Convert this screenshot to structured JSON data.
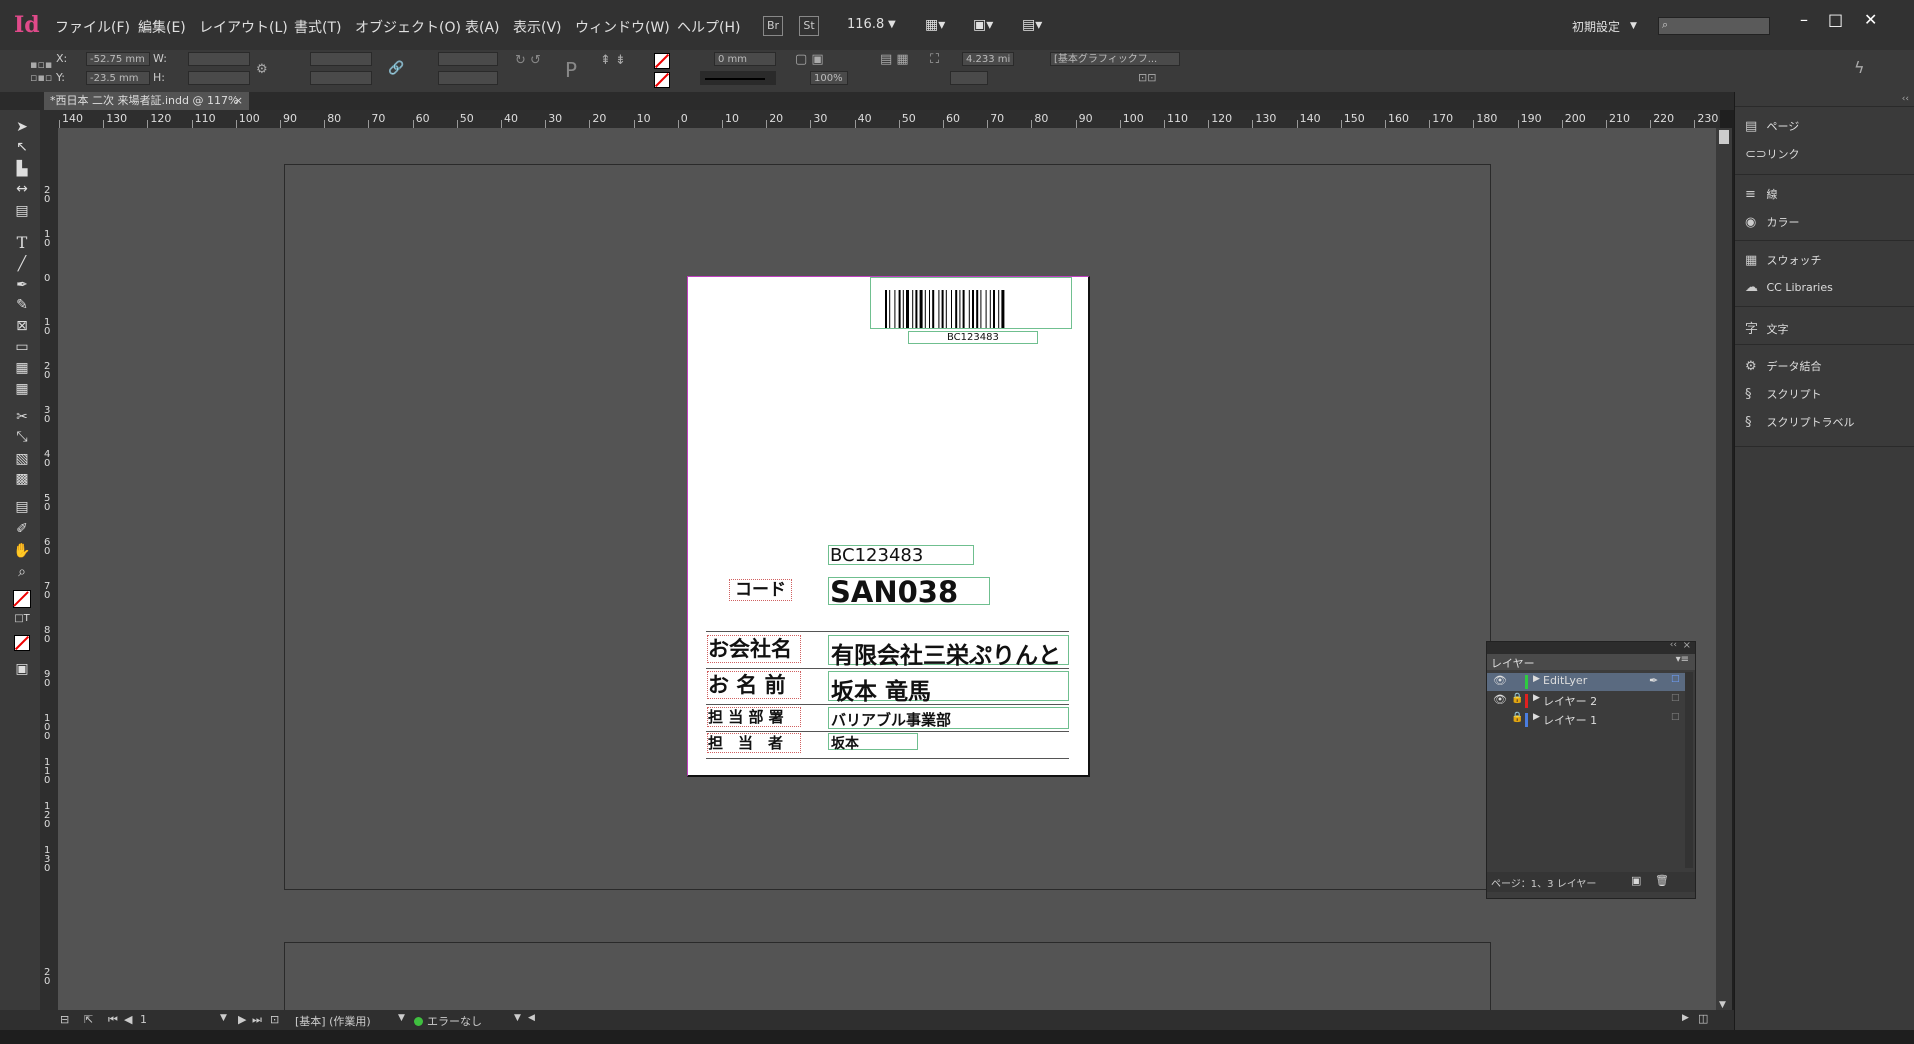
{
  "app": {
    "logo": "Id"
  },
  "menu": [
    "ファイル(F)",
    "編集(E)",
    "レイアウト(L)",
    "書式(T)",
    "オブジェクト(O)",
    "表(A)",
    "表示(V)",
    "ウィンドウ(W)",
    "ヘルプ(H)"
  ],
  "menubar": {
    "br": "Br",
    "st": "St",
    "zoom": "116.8",
    "workspace": "初期設定",
    "window_controls": [
      "–",
      "□",
      "✕"
    ]
  },
  "control": {
    "x_label": "X:",
    "x_value": "-52.75 mm",
    "y_label": "Y:",
    "y_value": "-23.5 mm",
    "w_label": "W:",
    "h_label": "H:",
    "stroke_weight": "0 mm",
    "opacity": "100%",
    "dimension": "4.233 mi",
    "object_style": "[基本グラフィックフ..."
  },
  "tab": {
    "title": "*西日本 二次 来場者証.indd @ 117%"
  },
  "ruler_h": [
    "140",
    "130",
    "120",
    "110",
    "100",
    "90",
    "80",
    "70",
    "60",
    "50",
    "40",
    "30",
    "20",
    "10",
    "0",
    "10",
    "20",
    "30",
    "40",
    "50",
    "60",
    "70",
    "80",
    "90",
    "100",
    "110",
    "120",
    "130",
    "140",
    "150",
    "160",
    "170",
    "180",
    "190",
    "200",
    "210",
    "220",
    "230"
  ],
  "ruler_v": [
    "2 0",
    "1 0",
    "0",
    "1 0",
    "2 0",
    "3 0",
    "4 0",
    "5 0",
    "6 0",
    "7 0",
    "8 0",
    "9 0",
    "1 0 0",
    "1 1 0",
    "1 2 0",
    "1 3 0",
    "2 0"
  ],
  "card": {
    "barcode_text": "BC123483",
    "code_small": "BC123483",
    "code_label": "コード",
    "code_value": "SAN038",
    "rows": [
      {
        "label": "お会社名",
        "value": "有限会社三栄ぷりんと"
      },
      {
        "label": "お 名 前",
        "value": "坂本 竜馬"
      },
      {
        "label": "担 当 部 署",
        "value": "バリアブル事業部"
      },
      {
        "label": "担　当　者",
        "value": "坂本"
      }
    ]
  },
  "dock": [
    {
      "icon": "pages-icon",
      "label": "ページ"
    },
    {
      "icon": "links-icon",
      "label": "リンク"
    },
    {
      "icon": "stroke-icon",
      "label": "線"
    },
    {
      "icon": "color-icon",
      "label": "カラー"
    },
    {
      "icon": "swatches-icon",
      "label": "スウォッチ"
    },
    {
      "icon": "cc-libraries-icon",
      "label": "CC Libraries"
    },
    {
      "icon": "character-icon",
      "label": "文字"
    },
    {
      "icon": "data-merge-icon",
      "label": "データ結合"
    },
    {
      "icon": "script-icon",
      "label": "スクリプト"
    },
    {
      "icon": "script-label-icon",
      "label": "スクリプトラベル"
    }
  ],
  "layers_panel": {
    "title": "レイヤー",
    "layers": [
      {
        "name": "EditLyer",
        "color": "#2ecc40",
        "visible": true,
        "locked": false,
        "selected": true
      },
      {
        "name": "レイヤー 2",
        "color": "#e02020",
        "visible": true,
        "locked": true,
        "selected": false
      },
      {
        "name": "レイヤー 1",
        "color": "#4a7de0",
        "visible": false,
        "locked": true,
        "selected": false
      }
    ],
    "footer": "ページ：1、3 レイヤー"
  },
  "status": {
    "page": "1",
    "master": "[基本] (作業用)",
    "preflight": "エラーなし"
  }
}
